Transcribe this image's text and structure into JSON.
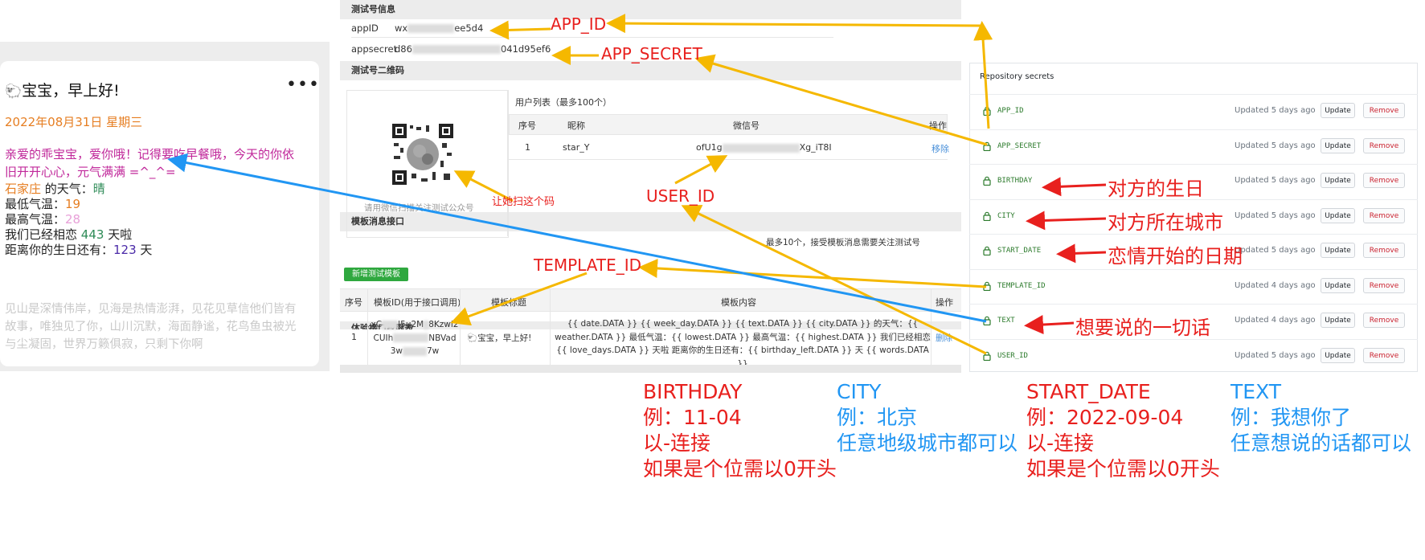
{
  "message_card": {
    "title": "宝宝，早上好!",
    "more": "•••",
    "date": "2022年08月31日 星期三",
    "greeting": "亲爱的乖宝宝，爱你哦！记得要吃早餐哦，今天的你依旧开开心心，元气满满 =^_^=",
    "city": "石家庄",
    "weather_label": " 的天气：",
    "weather": "晴",
    "low_label": "最低气温：",
    "low": "19",
    "high_label": "最高气温：",
    "high": "28",
    "love_prefix": "我们已经相恋 ",
    "love_days": "443",
    "love_suffix": " 天啦",
    "bday_prefix": "距离你的生日还有：",
    "bday_days": "123",
    "bday_suffix": " 天",
    "words": "见山是深情伟岸，见海是热情澎湃，见花见草信他们皆有故事，唯独见了你，山川沉默，海面静谧，花鸟鱼虫被光与尘凝固，世界万籁俱寂，只剩下你啊"
  },
  "wechat_panel": {
    "test_info_header": "测试号信息",
    "appid_label": "appID",
    "appid_prefix": "wx",
    "appid_suffix": "ee5d4",
    "appsecret_label": "appsecret",
    "appsecret_prefix": "d86",
    "appsecret_suffix": "041d95ef6",
    "qr_header": "测试号二维码",
    "qr_caption": "请用微信扫描关注测试公众号",
    "user_list_title": "用户列表（最多100个）",
    "user_cols": [
      "序号",
      "昵称",
      "微信号",
      "操作"
    ],
    "user_row": {
      "index": "1",
      "nickname": "star_Y",
      "wx_prefix": "ofU1g",
      "wx_suffix": "Xg_iT8I",
      "action": "移除"
    },
    "tpl_header": "模板消息接口",
    "tpl_add_button": "新增测试模板",
    "tpl_hint": "最多10个，接受模板消息需要关注测试号",
    "tpl_cols": [
      "序号",
      "模板ID(用于接口调用)",
      "模板标题",
      "模板内容",
      "操作"
    ],
    "tpl_row": {
      "index": "1",
      "id_line1_a": "xC",
      "id_line1_b": "I5u2M",
      "id_line1_c": "8Kzwl2",
      "id_line2_a": "CUIh",
      "id_line2_b": "NBVad",
      "id_line3_a": "3w",
      "id_line3_b": "7w",
      "title": "宝宝，早上好!",
      "content": "{{ date.DATA }} {{ week_day.DATA }} {{ text.DATA }} {{ city.DATA }} 的天气：{{ weather.DATA }} 最低气温：{{ lowest.DATA }} 最高气温：{{ highest.DATA }} 我们已经相恋 {{ love_days.DATA }} 天啦 距离你的生日还有：{{ birthday_left.DATA }} 天 {{ words.DATA }}",
      "action": "删除"
    },
    "tpl_footer": "体验接口权限表"
  },
  "repo_secrets": {
    "title": "Repository secrets",
    "update_label": "Update",
    "remove_label": "Remove",
    "items": [
      {
        "name": "APP_ID",
        "updated": "Updated 5 days ago"
      },
      {
        "name": "APP_SECRET",
        "updated": "Updated 5 days ago"
      },
      {
        "name": "BIRTHDAY",
        "updated": "Updated 5 days ago"
      },
      {
        "name": "CITY",
        "updated": "Updated 5 days ago"
      },
      {
        "name": "START_DATE",
        "updated": "Updated 5 days ago"
      },
      {
        "name": "TEMPLATE_ID",
        "updated": "Updated 4 days ago"
      },
      {
        "name": "TEXT",
        "updated": "Updated 4 days ago"
      },
      {
        "name": "USER_ID",
        "updated": "Updated 5 days ago"
      }
    ]
  },
  "annotations": {
    "app_id": "APP_ID",
    "app_secret": "APP_SECRET",
    "user_id": "USER_ID",
    "template_id": "TEMPLATE_ID",
    "scan_code": "让她扫这个码",
    "birthday": "对方的生日",
    "city": "对方所在城市",
    "start_date": "恋情开始的日期",
    "text": "想要说的一切话"
  },
  "notes": {
    "birthday": [
      "BIRTHDAY",
      "例：11-04",
      "以-连接",
      "如果是个位需以0开头"
    ],
    "city": [
      "CITY",
      "例：北京",
      "任意地级城市都可以"
    ],
    "start_date": [
      "START_DATE",
      "例：2022-09-04",
      "以-连接",
      "如果是个位需以0开头"
    ],
    "text": [
      "TEXT",
      "例：我想你了",
      "任意想说的话都可以"
    ]
  },
  "colors": {
    "annotation_red": "#e8201e",
    "annotation_blue": "#2196f3",
    "arrow_yellow": "#f5b800",
    "wechat_green": "#2fa83f"
  }
}
